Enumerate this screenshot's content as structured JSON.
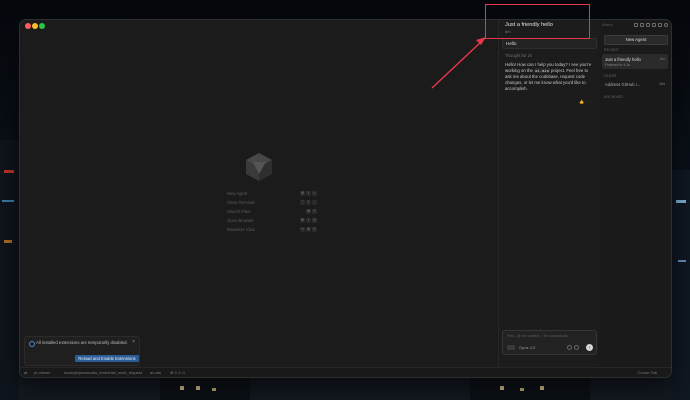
{
  "editor": {
    "shortcuts": [
      {
        "label": "New Agent",
        "keys": [
          "⌘",
          "⇧",
          "L"
        ]
      },
      {
        "label": "Show Terminal",
        "keys": [
          "⌃",
          "⇧",
          "`"
        ]
      },
      {
        "label": "Search Files",
        "keys": [
          "⌘",
          "P"
        ]
      },
      {
        "label": "Open Browser",
        "keys": [
          "⌘",
          "⇧",
          "B"
        ]
      },
      {
        "label": "Maximize Chat",
        "keys": [
          "⌥",
          "⌘",
          "E"
        ]
      }
    ]
  },
  "notification": {
    "message": "All installed extensions are temporarily disabled.",
    "action": "Reload and Enable Extensions",
    "close": "×"
  },
  "statusbar": {
    "branch": "pr-viewer",
    "path": "kovaujh/jonastudio_form/intel_work_request",
    "project": "ai-mia",
    "errors": "⊗ 0 ⚠ 0",
    "cursor_tab": "Cursor Tab"
  },
  "chat": {
    "title": "Just a friendly hello",
    "time": "6m",
    "user_message": "Hello",
    "thought": "Thought for 2s",
    "reply_before": "Hello! How can I help you today? I see you're working on the ",
    "reply_code": "ai-mia",
    "reply_after": " project. Feel free to ask me about the codebase, request code changes, or let me know what you'd like to accomplish.",
    "reply_actions": "👍 ···",
    "composer_placeholder": "Plan, @ for context, / for commands",
    "model": "Opus 4.5",
    "send_icon": "↑"
  },
  "agents": {
    "search_placeholder": "Search",
    "new_agent": "New Agent",
    "sections": {
      "recent": "RECENT",
      "older": "OLDER",
      "archived": "ARCHIVED"
    },
    "recent_items": [
      {
        "name": "Just a friendly hello",
        "sub": "Finished in 4.1s",
        "age": "6m"
      }
    ],
    "older_items": [
      {
        "name": "Address GitHub i...",
        "sub": "",
        "age": "38d"
      }
    ]
  },
  "colors": {
    "highlight": "#e8374a",
    "accent_button": "#2b5c96"
  }
}
